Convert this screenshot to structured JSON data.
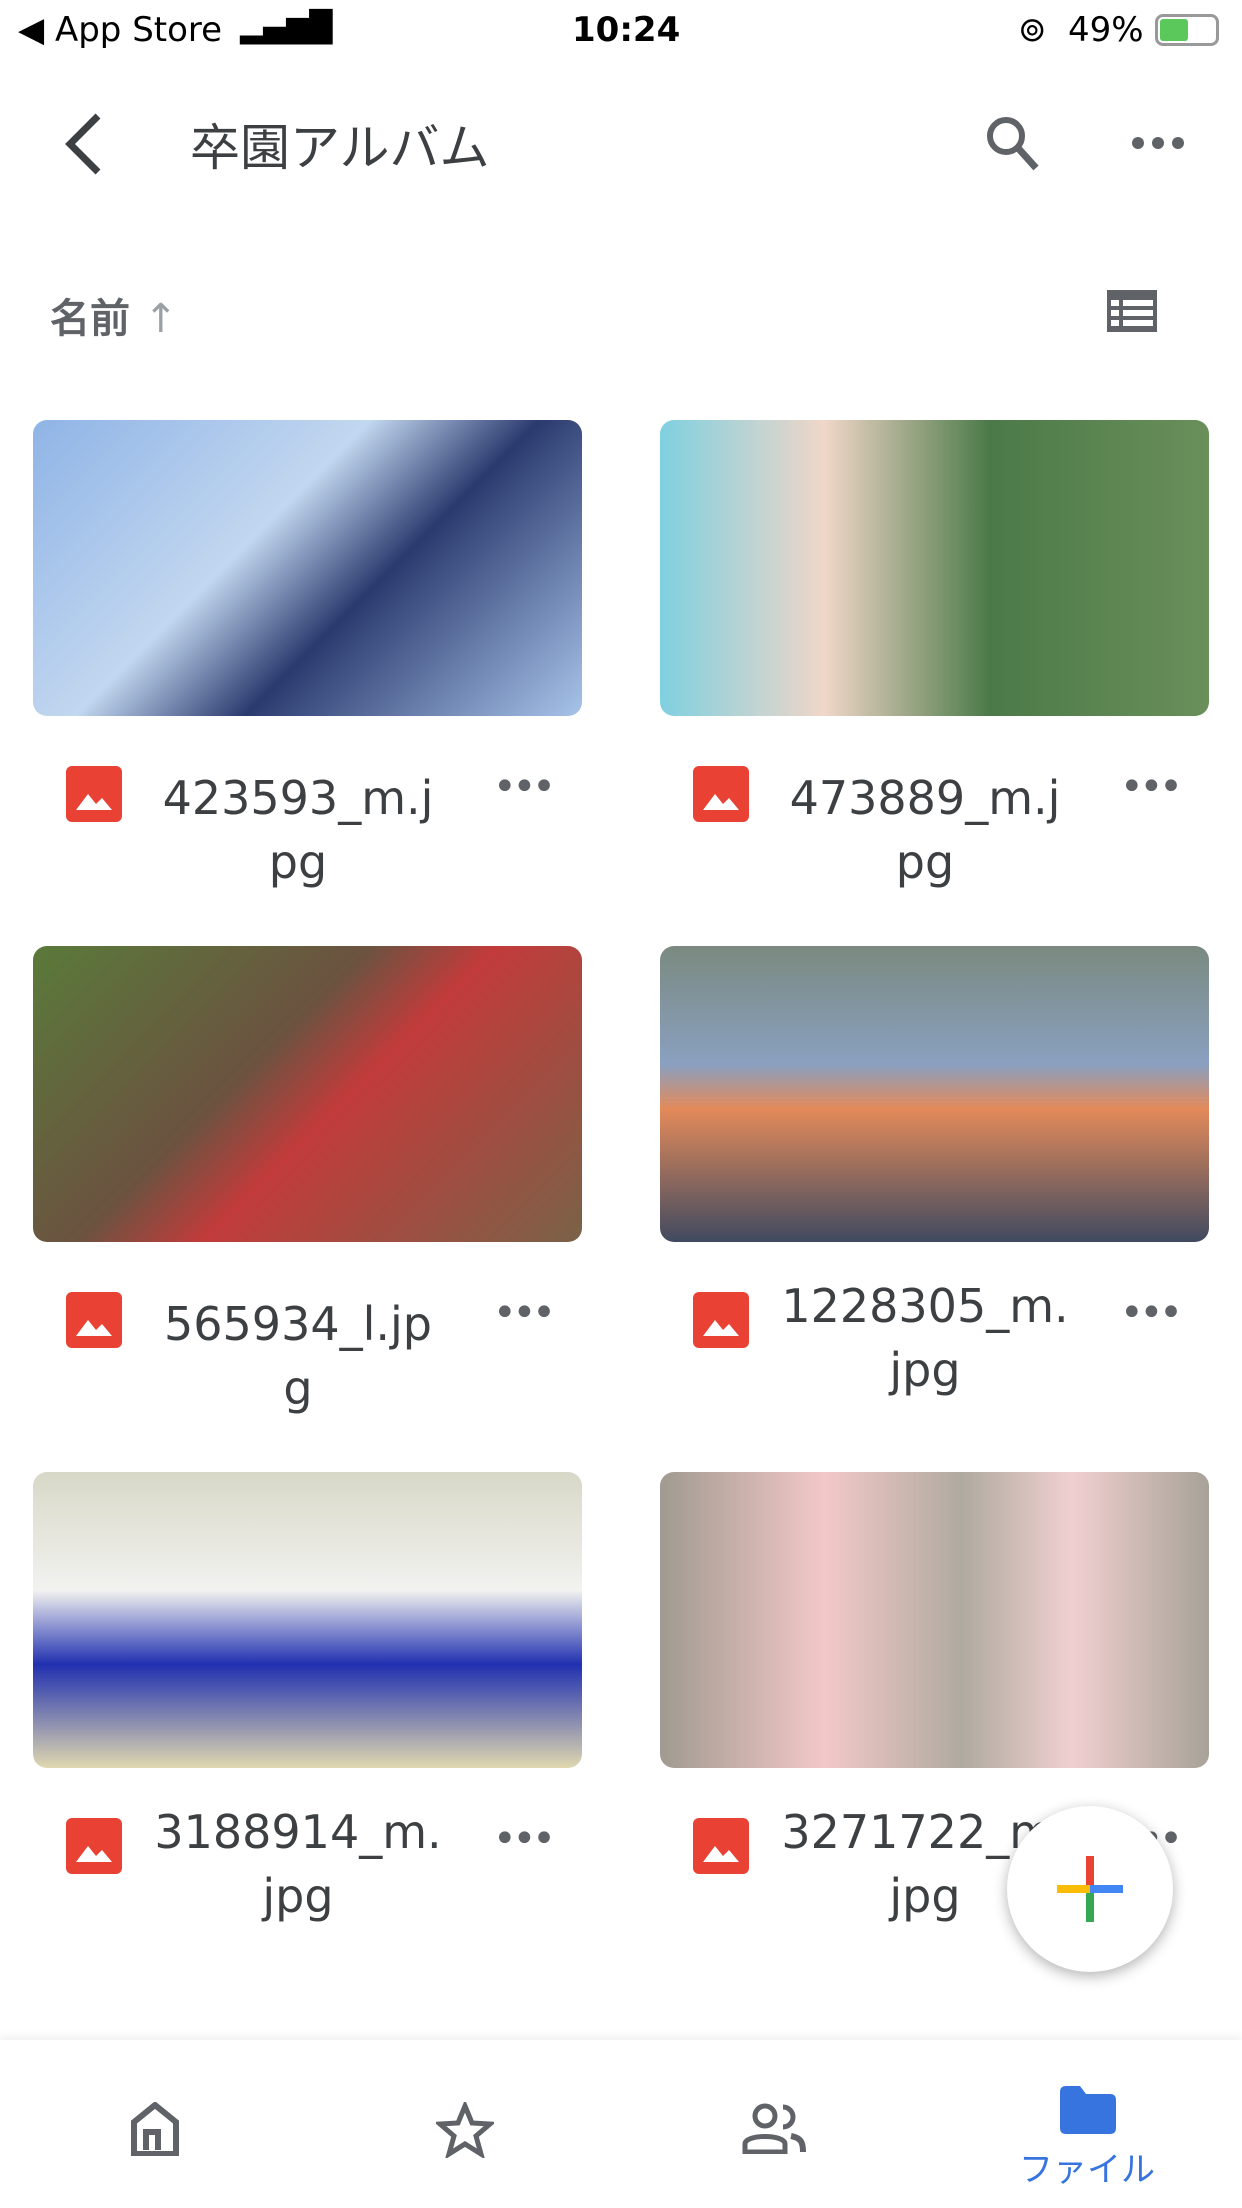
{
  "status_bar": {
    "back_app": "App Store",
    "time": "10:24",
    "battery": "49%",
    "battery_level": 49
  },
  "header": {
    "title": "卒園アルバム",
    "back_icon": "chevron-left-icon",
    "search_icon": "search-icon",
    "more_icon": "more-horiz-icon"
  },
  "sort": {
    "label": "名前",
    "direction_icon": "arrow-up-icon",
    "view_icon": "list-view-icon"
  },
  "files": [
    {
      "name": "423593_m.jpg",
      "icon": "image-file-icon"
    },
    {
      "name": "473889_m.jpg",
      "icon": "image-file-icon"
    },
    {
      "name": "565934_l.jpg",
      "icon": "image-file-icon"
    },
    {
      "name": "1228305_m.jpg",
      "icon": "image-file-icon"
    },
    {
      "name": "3188914_m.jpg",
      "icon": "image-file-icon"
    },
    {
      "name": "3271722_m.jpg",
      "icon": "image-file-icon"
    }
  ],
  "fab": {
    "icon": "plus-icon"
  },
  "bottom_nav": {
    "items": [
      {
        "icon": "home-icon",
        "label": ""
      },
      {
        "icon": "star-icon",
        "label": ""
      },
      {
        "icon": "shared-people-icon",
        "label": ""
      },
      {
        "icon": "folder-icon",
        "label": "ファイル",
        "active": true
      }
    ]
  },
  "colors": {
    "accent": "#3874e0",
    "file_icon": "#e94235",
    "text": "#3c4043"
  }
}
